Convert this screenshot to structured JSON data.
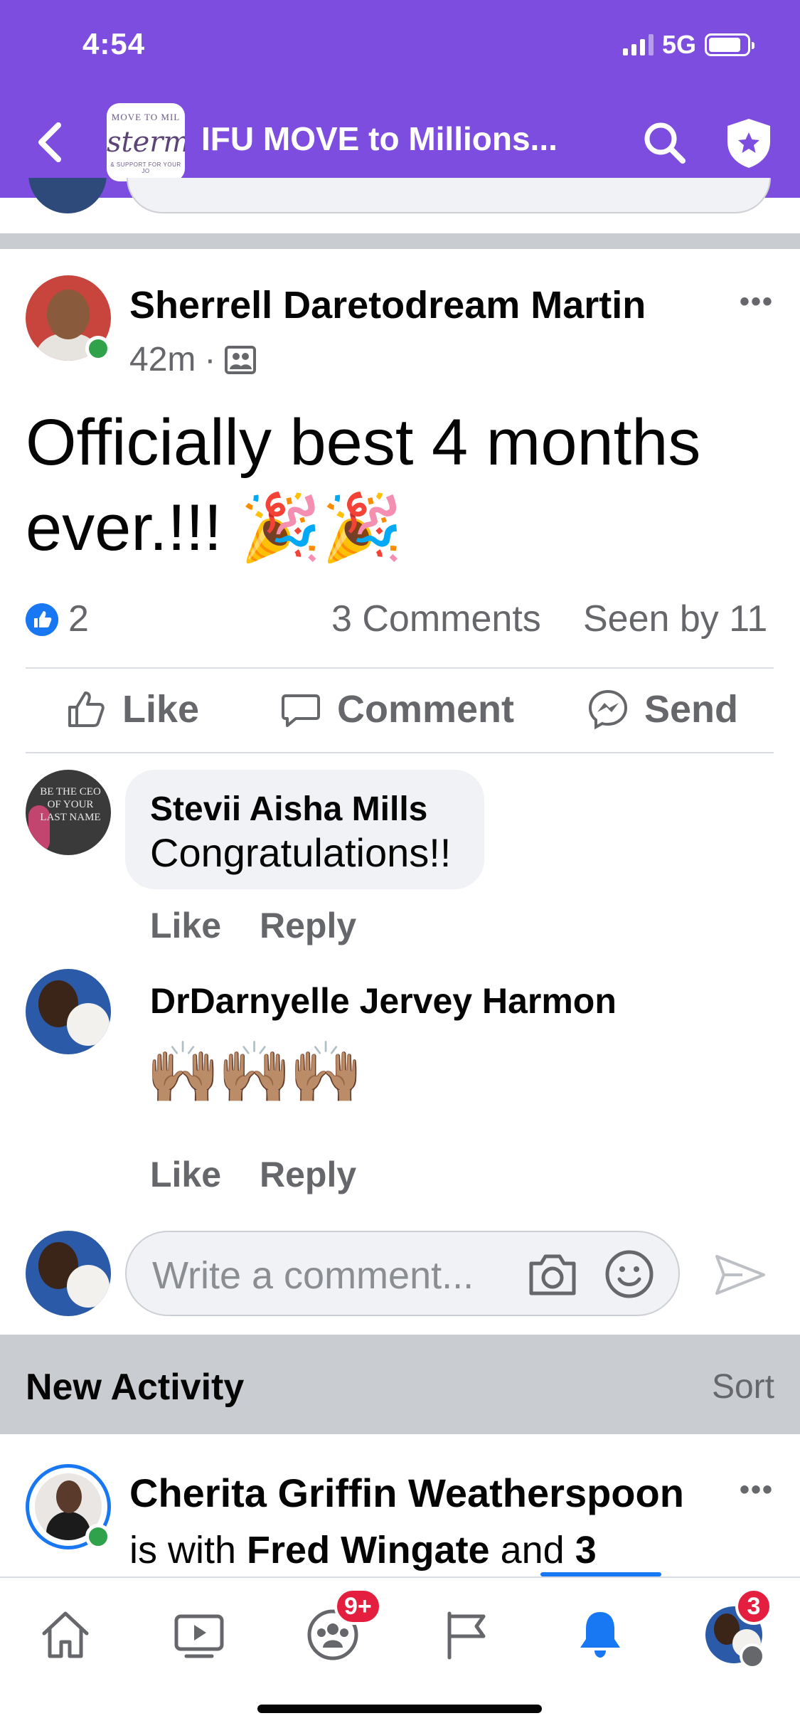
{
  "status_bar": {
    "time": "4:54",
    "network": "5G"
  },
  "header": {
    "group_title": "IFU MOVE to Millions...",
    "logo_text_top": "MOVE TO MIL",
    "logo_text_script": "sterm",
    "logo_text_bottom": "& SUPPORT FOR YOUR JO"
  },
  "post": {
    "author": "Sherrell Daretodream Martin",
    "time": "42m",
    "text": "Officially best 4 months ever.!!! 🎉🎉",
    "like_count": "2",
    "comments_count": "3 Comments",
    "seen_by": "Seen by 11",
    "actions": {
      "like": "Like",
      "comment": "Comment",
      "send": "Send"
    }
  },
  "comments": [
    {
      "author": "Stevii Aisha Mills",
      "text": "Congratulations!!",
      "like_label": "Like",
      "reply_label": "Reply",
      "avatar_text": "BE THE CEO OF YOUR LAST NAME"
    },
    {
      "author": "DrDarnyelle Jervey Harmon",
      "text": "🙌🏽🙌🏽🙌🏽",
      "like_label": "Like",
      "reply_label": "Reply"
    }
  ],
  "write_comment": {
    "placeholder": "Write a comment..."
  },
  "new_activity": {
    "title": "New Activity",
    "sort_label": "Sort"
  },
  "next_post": {
    "author": "Cherita Griffin Weatherspoon",
    "line_prefix": "is with",
    "tagged": "Fred Wingate",
    "line_conj": "and",
    "others": "3"
  },
  "tabbar": {
    "tabs": [
      "home-icon",
      "watch-icon",
      "groups-icon",
      "pages-icon",
      "notifications-icon",
      "profile-menu"
    ],
    "groups_badge": "9+",
    "profile_badge": "3"
  },
  "colors": {
    "brand_purple": "#7c4ddf",
    "facebook_blue": "#1877f2",
    "badge_red": "#e41e3f",
    "online_green": "#31a24c"
  }
}
